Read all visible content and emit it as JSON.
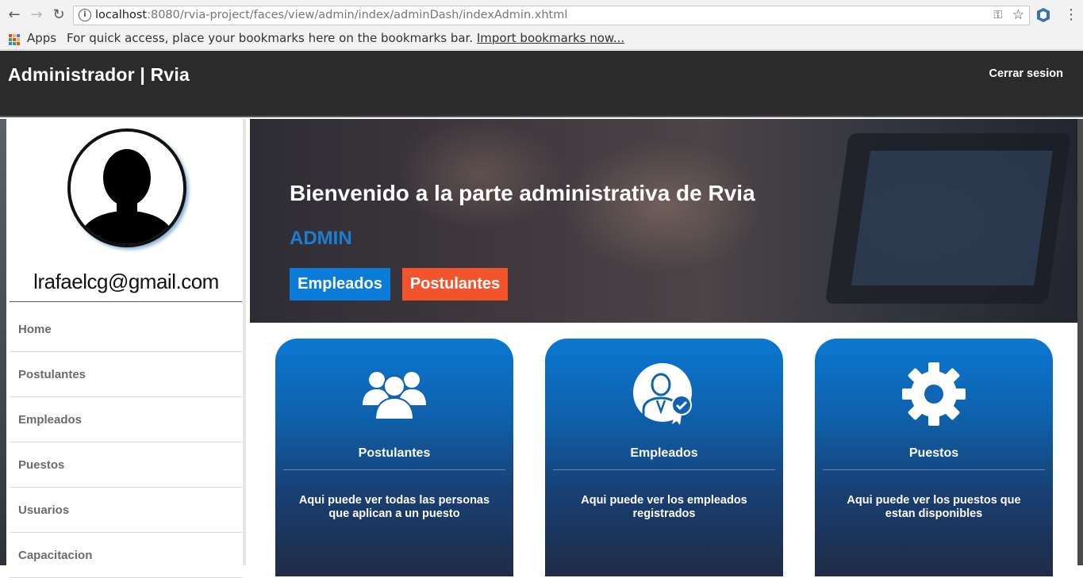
{
  "browser": {
    "url_host": "localhost",
    "url_path": ":8080/rvia-project/faces/view/admin/index/adminDash/indexAdmin.xhtml",
    "bookmarks_apps": "Apps",
    "bookmarks_hint": "For quick access, place your bookmarks here on the bookmarks bar.",
    "bookmarks_import": "Import bookmarks now..."
  },
  "header": {
    "brand": "Administrador | Rvia",
    "logout_label": "Cerrar sesion"
  },
  "sidebar": {
    "email": "lrafaelcg@gmail.com",
    "items": [
      {
        "label": "Home"
      },
      {
        "label": "Postulantes"
      },
      {
        "label": "Empleados"
      },
      {
        "label": "Puestos"
      },
      {
        "label": "Usuarios"
      },
      {
        "label": "Capacitacion"
      }
    ]
  },
  "hero": {
    "title": "Bienvenido a la parte administrativa de Rvia",
    "role": "ADMIN",
    "btn_empleados": "Empleados",
    "btn_postulantes": "Postulantes"
  },
  "cards": [
    {
      "icon": "users-group-icon",
      "title": "Postulantes",
      "description": "Aqui puede ver todas las personas que aplican a un puesto"
    },
    {
      "icon": "employee-badge-icon",
      "title": "Empleados",
      "description": "Aqui puede ver los empleados registrados"
    },
    {
      "icon": "gear-icon",
      "title": "Puestos",
      "description": "Aqui puede ver los puestos que estan disponibles"
    }
  ],
  "colors": {
    "header_bg": "#2b2b2b",
    "accent_blue": "#0b7dd8",
    "accent_orange": "#f2552d",
    "card_top": "#0b78d2",
    "card_bottom": "#1f2c45"
  }
}
